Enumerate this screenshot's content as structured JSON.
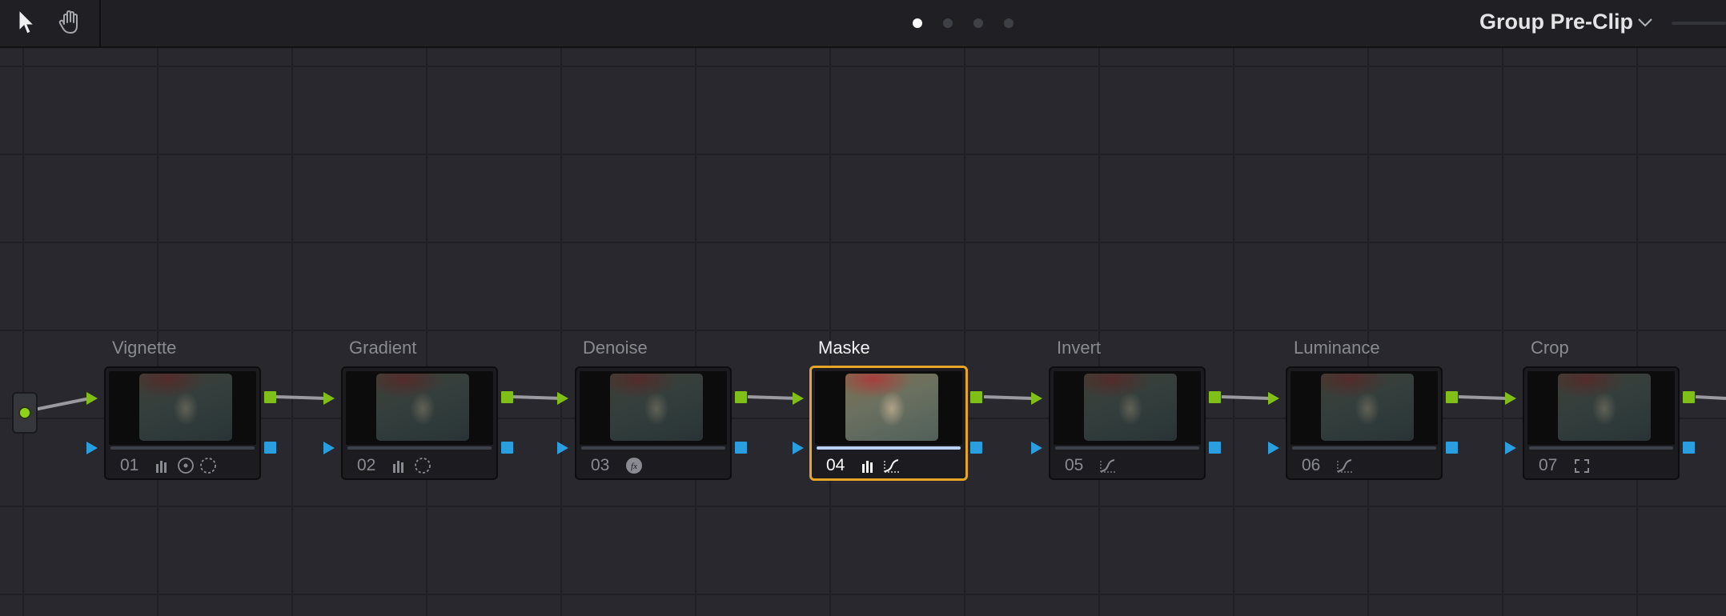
{
  "toolbar": {
    "tools": [
      {
        "name": "pointer-tool",
        "icon": "arrow-pointer-icon"
      },
      {
        "name": "hand-tool",
        "icon": "hand-pan-icon"
      }
    ],
    "pages": [
      {
        "index": 1,
        "active": true
      },
      {
        "index": 2,
        "active": false
      },
      {
        "index": 3,
        "active": false
      },
      {
        "index": 4,
        "active": false
      }
    ],
    "mode_label": "Group Pre-Clip",
    "mode_chevron_icon": "chevron-down-icon"
  },
  "colors": {
    "rgb_port": "#7fbf18",
    "key_port": "#2a9fe0",
    "selection": "#e6a526",
    "wire": "#9a9aa0"
  },
  "nodes": [
    {
      "label": "Vignette",
      "number": "01",
      "tools": [
        "bars-icon",
        "circle-window-icon",
        "dashed-circle-icon"
      ]
    },
    {
      "label": "Gradient",
      "number": "02",
      "tools": [
        "bars-icon",
        "dashed-circle-icon"
      ]
    },
    {
      "label": "Denoise",
      "number": "03",
      "tools": [
        "fx-icon"
      ]
    },
    {
      "label": "Maske",
      "number": "04",
      "tools": [
        "bars-icon",
        "curves-icon"
      ],
      "selected": true
    },
    {
      "label": "Invert",
      "number": "05",
      "tools": [
        "curves-icon"
      ]
    },
    {
      "label": "Luminance",
      "number": "06",
      "tools": [
        "curves-icon"
      ]
    },
    {
      "label": "Crop",
      "number": "07",
      "tools": [
        "sizing-icon"
      ]
    }
  ]
}
